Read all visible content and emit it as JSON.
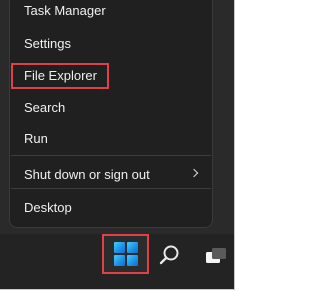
{
  "context_menu": {
    "items": [
      {
        "label": "Task Manager"
      },
      {
        "label": "Settings"
      },
      {
        "label": "File Explorer",
        "highlighted": true
      },
      {
        "label": "Search"
      },
      {
        "label": "Run"
      },
      {
        "label": "Shut down or sign out",
        "has_submenu": true
      },
      {
        "label": "Desktop"
      }
    ]
  },
  "taskbar": {
    "start_button": {
      "icon": "windows-logo-icon",
      "highlighted": true
    },
    "search_button": {
      "icon": "search-icon"
    },
    "task_view_button": {
      "icon": "task-view-icon"
    }
  },
  "colors": {
    "menu_background": "#202020",
    "menu_text": "#f0f0f0",
    "taskbar_background": "#232323",
    "highlight_outline": "#e0404a",
    "windows_logo": "#1a8fe6"
  }
}
